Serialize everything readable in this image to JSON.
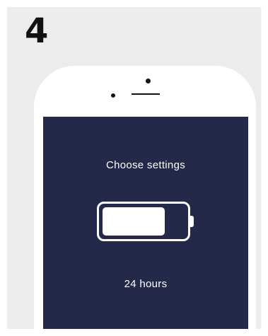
{
  "step": {
    "number": "4"
  },
  "screen": {
    "title": "Choose settings",
    "battery": {
      "level": 0.76,
      "label": "24 hours"
    }
  },
  "colors": {
    "panel_background": "#ececec",
    "phone_body": "#ffffff",
    "screen_background": "#24294a",
    "text_on_screen": "#ffffff",
    "step_number": "#111111"
  },
  "icons": {
    "battery": "battery-icon",
    "camera": "camera-dot-icon",
    "sensor": "sensor-dot-icon",
    "speaker": "speaker-icon"
  }
}
